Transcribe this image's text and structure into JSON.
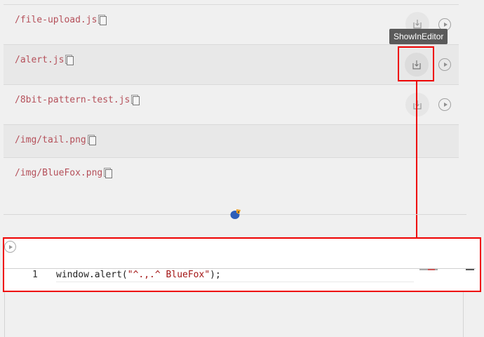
{
  "files": [
    {
      "name": "/file-upload.js",
      "actions": true
    },
    {
      "name": "/alert.js",
      "actions": true
    },
    {
      "name": "/8bit-pattern-test.js",
      "actions": true
    },
    {
      "name": "/img/tail.png",
      "actions": false
    },
    {
      "name": "/img/BlueFox.png",
      "actions": false
    }
  ],
  "tooltip": "ShowInEditor",
  "editor": {
    "line_number": "1",
    "code_prefix": "window.alert(",
    "code_string": "\"^.,.^ BlueFox\"",
    "code_suffix": ");"
  },
  "colors": {
    "highlight": "#e00000",
    "filename": "#b5505a",
    "string": "#a31515"
  }
}
